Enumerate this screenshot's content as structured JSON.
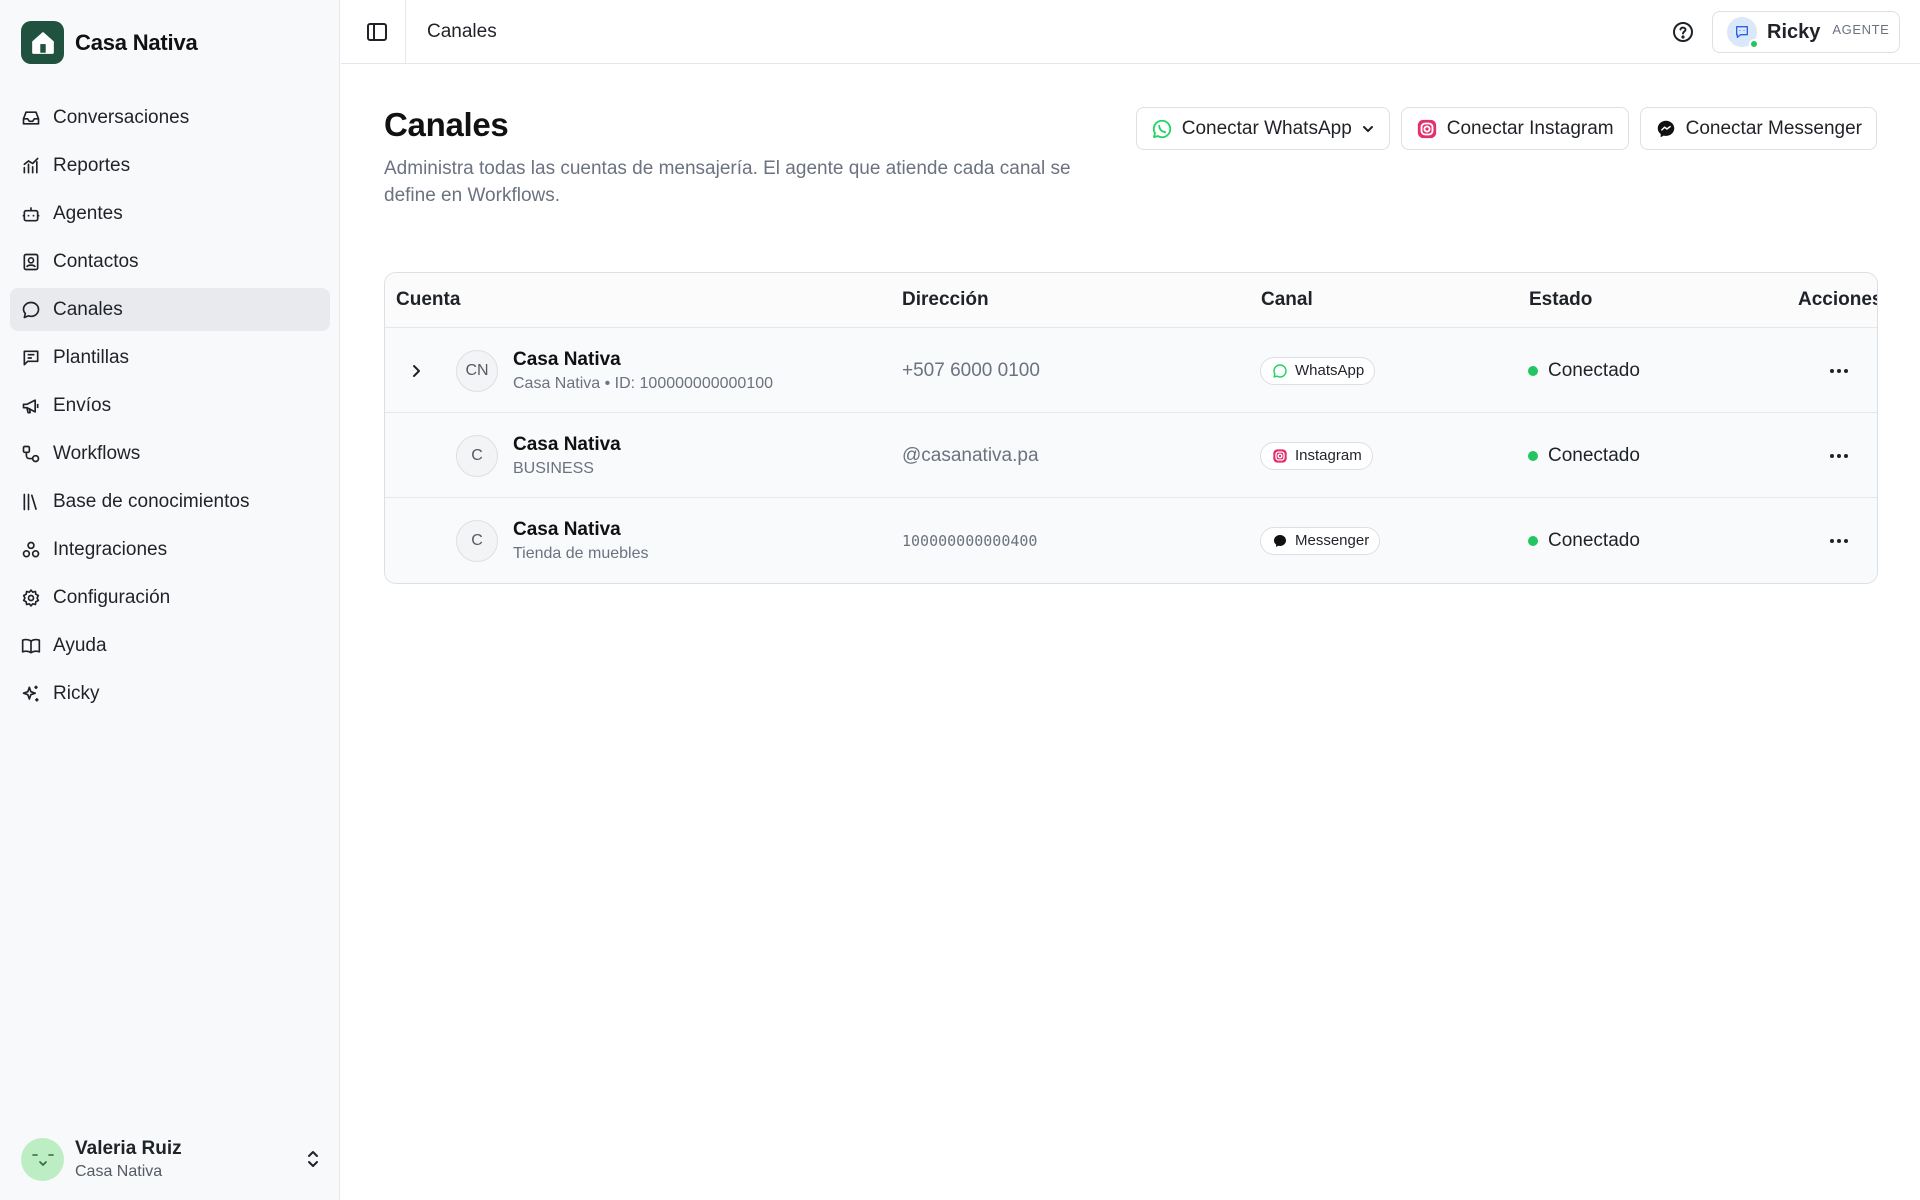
{
  "brand": {
    "name": "Casa Nativa"
  },
  "sidebar": {
    "items": [
      {
        "label": "Conversaciones",
        "icon": "inbox-icon"
      },
      {
        "label": "Reportes",
        "icon": "chart-icon"
      },
      {
        "label": "Agentes",
        "icon": "bot-icon"
      },
      {
        "label": "Contactos",
        "icon": "contact-icon"
      },
      {
        "label": "Canales",
        "icon": "chat-bubble-icon",
        "active": true
      },
      {
        "label": "Plantillas",
        "icon": "template-icon"
      },
      {
        "label": "Envíos",
        "icon": "megaphone-icon"
      },
      {
        "label": "Workflows",
        "icon": "workflow-icon"
      },
      {
        "label": "Base de conocimientos",
        "icon": "library-icon"
      },
      {
        "label": "Integraciones",
        "icon": "integrations-icon"
      },
      {
        "label": "Configuración",
        "icon": "gear-icon"
      },
      {
        "label": "Ayuda",
        "icon": "book-icon"
      },
      {
        "label": "Ricky",
        "icon": "sparkles-icon"
      }
    ]
  },
  "user": {
    "name": "Valeria Ruiz",
    "org": "Casa Nativa"
  },
  "topbar": {
    "breadcrumb": "Canales",
    "agent_name": "Ricky",
    "agent_role": "AGENTE"
  },
  "page": {
    "title": "Canales",
    "description": "Administra todas las cuentas de mensajería. El agente que atiende cada canal se define en Workflows."
  },
  "actions": {
    "whatsapp": "Conectar WhatsApp",
    "instagram": "Conectar Instagram",
    "messenger": "Conectar Messenger"
  },
  "table": {
    "headers": {
      "cuenta": "Cuenta",
      "direccion": "Dirección",
      "canal": "Canal",
      "estado": "Estado",
      "acciones": "Acciones"
    },
    "rows": [
      {
        "initials": "CN",
        "name": "Casa Nativa",
        "sub": "Casa Nativa • ID: 100000000000100",
        "address": "+507 6000 0100",
        "channel": "WhatsApp",
        "status": "Conectado"
      },
      {
        "initials": "C",
        "name": "Casa Nativa",
        "sub": "BUSINESS",
        "address": "@casanativa.pa",
        "channel": "Instagram",
        "status": "Conectado"
      },
      {
        "initials": "C",
        "name": "Casa Nativa",
        "sub": "Tienda de muebles",
        "address": "100000000000400",
        "channel": "Messenger",
        "status": "Conectado"
      }
    ]
  },
  "colors": {
    "brand": "#21523f",
    "status_connected": "#22c55e",
    "whatsapp": "#25D366",
    "instagram": "#E1306C"
  }
}
